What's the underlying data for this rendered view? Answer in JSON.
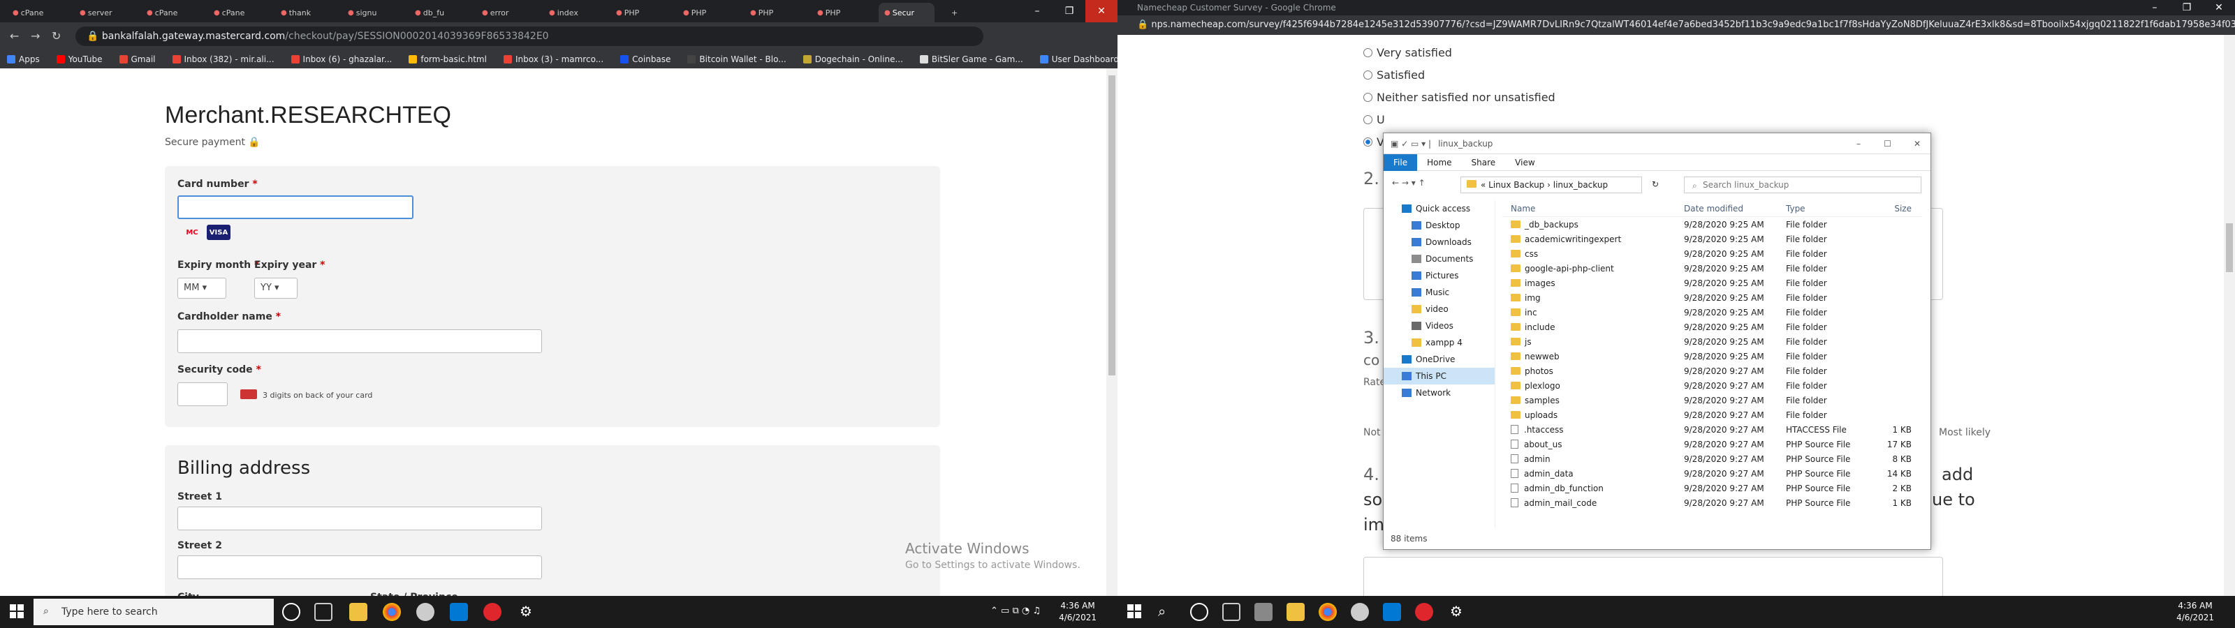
{
  "left": {
    "tabs": [
      {
        "label": "cPane"
      },
      {
        "label": "server"
      },
      {
        "label": "cPane"
      },
      {
        "label": "cPane"
      },
      {
        "label": "thank"
      },
      {
        "label": "signu"
      },
      {
        "label": "db_fu"
      },
      {
        "label": "error"
      },
      {
        "label": "index"
      },
      {
        "label": "PHP"
      },
      {
        "label": "PHP"
      },
      {
        "label": "PHP"
      },
      {
        "label": "PHP"
      },
      {
        "label": "Secur"
      }
    ],
    "url": {
      "domain": "bankalfalah.gateway.mastercard.com",
      "path": "/checkout/pay/SESSION0002014039369F86533842E0"
    },
    "bookmarks": [
      {
        "label": "Apps",
        "color": "#4285f4"
      },
      {
        "label": "YouTube",
        "color": "#ff0000"
      },
      {
        "label": "Gmail",
        "color": "#ea4335"
      },
      {
        "label": "Inbox (382) - mir.ali...",
        "color": "#ea4335"
      },
      {
        "label": "Inbox (6) - ghazalar...",
        "color": "#ea4335"
      },
      {
        "label": "form-basic.html",
        "color": "#fbbc04"
      },
      {
        "label": "Inbox (3) - mamrco...",
        "color": "#ea4335"
      },
      {
        "label": "Coinbase",
        "color": "#1652f0"
      },
      {
        "label": "Bitcoin Wallet - Blo...",
        "color": "#444"
      },
      {
        "label": "Dogechain - Online...",
        "color": "#c2a633"
      },
      {
        "label": "BitSler Game - Gam...",
        "color": "#ddd"
      },
      {
        "label": "User Dashboard | F...",
        "color": "#4285f4"
      }
    ],
    "page": {
      "merchant": "Merchant.RESEARCHTEQ",
      "secure": "Secure payment 🔒",
      "card_number_label": "Card number",
      "expiry_month_label": "Expiry month",
      "expiry_year_label": "Expiry year",
      "month_value": "MM",
      "year_value": "YY",
      "cardholder_label": "Cardholder name",
      "security_label": "Security code",
      "security_hint": "3 digits on back of your card",
      "req": "*",
      "billing_title": "Billing address",
      "street1_label": "Street 1",
      "street2_label": "Street 2",
      "city_label": "City",
      "state_label": "State / Province",
      "mastercard": "MC",
      "visa": "VISA"
    },
    "watermark": {
      "line1": "Activate Windows",
      "line2": "Go to Settings to activate Windows."
    },
    "taskbar": {
      "search": "Type here to search",
      "time": "4:36 AM",
      "date": "4/6/2021"
    }
  },
  "right": {
    "title": "Namecheap Customer Survey - Google Chrome",
    "url": "nps.namecheap.com/survey/f425f6944b7284e1245e312d53907776/?csd=JZ9WAMR7DvLIRn9c7QtzalWT46014ef4e7a6bed3452bf11b3c9a9edc9a1bc1f7f8sHdaYyZoN8DfJKeluuaZ4rE3xlk8&sd=8Tbooilx54xjgq0211822f1f6dab17958e34f030cab23d288e...",
    "radios": [
      "Very satisfied",
      "Satisfied",
      "Neither satisfied nor unsatisfied",
      "U",
      "V"
    ],
    "q2": "2.",
    "q3": "3.",
    "co": "co",
    "rate": "Rate",
    "not": "Not",
    "most_likely": "Most likely",
    "q4": "4.",
    "q4_tail_a": "add",
    "q4_tail_b": "so",
    "q4_tail_c": "ue to",
    "improve": "improve.",
    "taskbar": {
      "time": "4:36 AM",
      "date": "4/6/2021"
    },
    "explorer": {
      "title": "linux_backup",
      "ribbon": [
        "File",
        "Home",
        "Share",
        "View"
      ],
      "address": [
        "Linux Backup",
        "linux_backup"
      ],
      "search_placeholder": "Search linux_backup",
      "nav": [
        {
          "label": "Quick access",
          "icon": "star-icon",
          "color": "#1979ca"
        },
        {
          "label": "Desktop",
          "icon": "desktop-icon",
          "color": "#3a7bd5"
        },
        {
          "label": "Downloads",
          "icon": "download-icon",
          "color": "#3a7bd5"
        },
        {
          "label": "Documents",
          "icon": "documents-icon",
          "color": "#8c8c8c"
        },
        {
          "label": "Pictures",
          "icon": "pictures-icon",
          "color": "#3a7bd5"
        },
        {
          "label": "Music",
          "icon": "music-icon",
          "color": "#3a7bd5"
        },
        {
          "label": "video",
          "icon": "folder-icon",
          "color": "#f0c040"
        },
        {
          "label": "Videos",
          "icon": "videos-icon",
          "color": "#6a6a6a"
        },
        {
          "label": "xampp 4",
          "icon": "folder-icon",
          "color": "#f0c040"
        },
        {
          "label": "OneDrive",
          "icon": "onedrive-icon",
          "color": "#1979ca"
        },
        {
          "label": "This PC",
          "icon": "computer-icon",
          "color": "#3a7bd5"
        },
        {
          "label": "Network",
          "icon": "network-icon",
          "color": "#3a7bd5"
        }
      ],
      "columns": [
        "Name",
        "Date modified",
        "Type",
        "Size"
      ],
      "rows": [
        {
          "name": "_db_backups",
          "date": "9/28/2020 9:25 AM",
          "type": "File folder",
          "size": "",
          "folder": true
        },
        {
          "name": "academicwritingexpert",
          "date": "9/28/2020 9:25 AM",
          "type": "File folder",
          "size": "",
          "folder": true
        },
        {
          "name": "css",
          "date": "9/28/2020 9:25 AM",
          "type": "File folder",
          "size": "",
          "folder": true
        },
        {
          "name": "google-api-php-client",
          "date": "9/28/2020 9:25 AM",
          "type": "File folder",
          "size": "",
          "folder": true
        },
        {
          "name": "images",
          "date": "9/28/2020 9:25 AM",
          "type": "File folder",
          "size": "",
          "folder": true
        },
        {
          "name": "img",
          "date": "9/28/2020 9:25 AM",
          "type": "File folder",
          "size": "",
          "folder": true
        },
        {
          "name": "inc",
          "date": "9/28/2020 9:25 AM",
          "type": "File folder",
          "size": "",
          "folder": true
        },
        {
          "name": "include",
          "date": "9/28/2020 9:25 AM",
          "type": "File folder",
          "size": "",
          "folder": true
        },
        {
          "name": "js",
          "date": "9/28/2020 9:25 AM",
          "type": "File folder",
          "size": "",
          "folder": true
        },
        {
          "name": "newweb",
          "date": "9/28/2020 9:25 AM",
          "type": "File folder",
          "size": "",
          "folder": true
        },
        {
          "name": "photos",
          "date": "9/28/2020 9:27 AM",
          "type": "File folder",
          "size": "",
          "folder": true
        },
        {
          "name": "plexlogo",
          "date": "9/28/2020 9:27 AM",
          "type": "File folder",
          "size": "",
          "folder": true
        },
        {
          "name": "samples",
          "date": "9/28/2020 9:27 AM",
          "type": "File folder",
          "size": "",
          "folder": true
        },
        {
          "name": "uploads",
          "date": "9/28/2020 9:27 AM",
          "type": "File folder",
          "size": "",
          "folder": true
        },
        {
          "name": ".htaccess",
          "date": "9/28/2020 9:27 AM",
          "type": "HTACCESS File",
          "size": "1 KB",
          "folder": false
        },
        {
          "name": "about_us",
          "date": "9/28/2020 9:27 AM",
          "type": "PHP Source File",
          "size": "17 KB",
          "folder": false
        },
        {
          "name": "admin",
          "date": "9/28/2020 9:27 AM",
          "type": "PHP Source File",
          "size": "8 KB",
          "folder": false
        },
        {
          "name": "admin_data",
          "date": "9/28/2020 9:27 AM",
          "type": "PHP Source File",
          "size": "14 KB",
          "folder": false
        },
        {
          "name": "admin_db_function",
          "date": "9/28/2020 9:27 AM",
          "type": "PHP Source File",
          "size": "2 KB",
          "folder": false
        },
        {
          "name": "admin_mail_code",
          "date": "9/28/2020 9:27 AM",
          "type": "PHP Source File",
          "size": "1 KB",
          "folder": false
        }
      ],
      "status": "88 items"
    }
  }
}
